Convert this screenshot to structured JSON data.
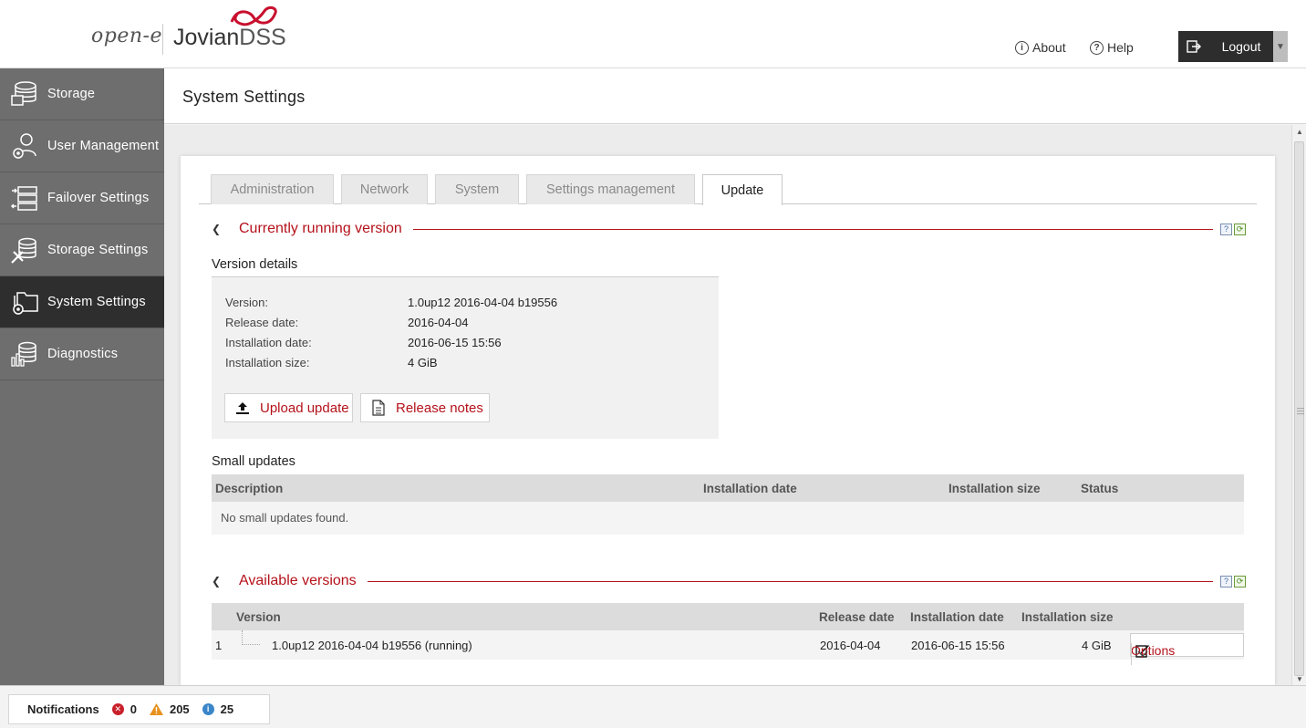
{
  "header": {
    "brand_prefix": "open-e",
    "brand_name": "Jovian",
    "brand_suffix": "DSS",
    "about_label": "About",
    "help_label": "Help",
    "logout_label": "Logout"
  },
  "sidebar": {
    "items": [
      {
        "label": "Storage",
        "icon": "database-icon"
      },
      {
        "label": "User Management",
        "icon": "user-gear-icon"
      },
      {
        "label": "Failover Settings",
        "icon": "failover-icon"
      },
      {
        "label": "Storage Settings",
        "icon": "storage-tools-icon"
      },
      {
        "label": "System Settings",
        "icon": "folder-gear-icon"
      },
      {
        "label": "Diagnostics",
        "icon": "diagnostics-icon"
      }
    ],
    "active": "System Settings"
  },
  "page": {
    "title": "System Settings"
  },
  "tabs": [
    {
      "label": "Administration"
    },
    {
      "label": "Network"
    },
    {
      "label": "System"
    },
    {
      "label": "Settings management"
    },
    {
      "label": "Update"
    }
  ],
  "current": {
    "section_title": "Currently running version",
    "details_label": "Version details",
    "fields": [
      {
        "key": "Version:",
        "value": "1.0up12 2016-04-04 b19556"
      },
      {
        "key": "Release date:",
        "value": "2016-04-04"
      },
      {
        "key": "Installation date:",
        "value": "2016-06-15 15:56"
      },
      {
        "key": "Installation size:",
        "value": "4 GiB"
      }
    ],
    "upload_label": "Upload update",
    "notes_label": "Release notes"
  },
  "small_updates": {
    "label": "Small updates",
    "columns": [
      "Description",
      "Installation date",
      "Installation size",
      "Status"
    ],
    "empty_message": "No small updates found."
  },
  "available": {
    "section_title": "Available versions",
    "columns": [
      "Version",
      "Release date",
      "Installation date",
      "Installation size"
    ],
    "rows": [
      {
        "index": "1",
        "version": "1.0up12 2016-04-04 b19556 (running)",
        "release_date": "2016-04-04",
        "installation_date": "2016-06-15 15:56",
        "installation_size": "4 GiB"
      }
    ],
    "options_label": "Options"
  },
  "footer": {
    "notifications_label": "Notifications",
    "errors": "0",
    "warnings": "205",
    "info": "25"
  },
  "colors": {
    "accent": "#b5121b",
    "sidebar": "#6e6e6e",
    "sidebar_active": "#2e2e2e"
  }
}
